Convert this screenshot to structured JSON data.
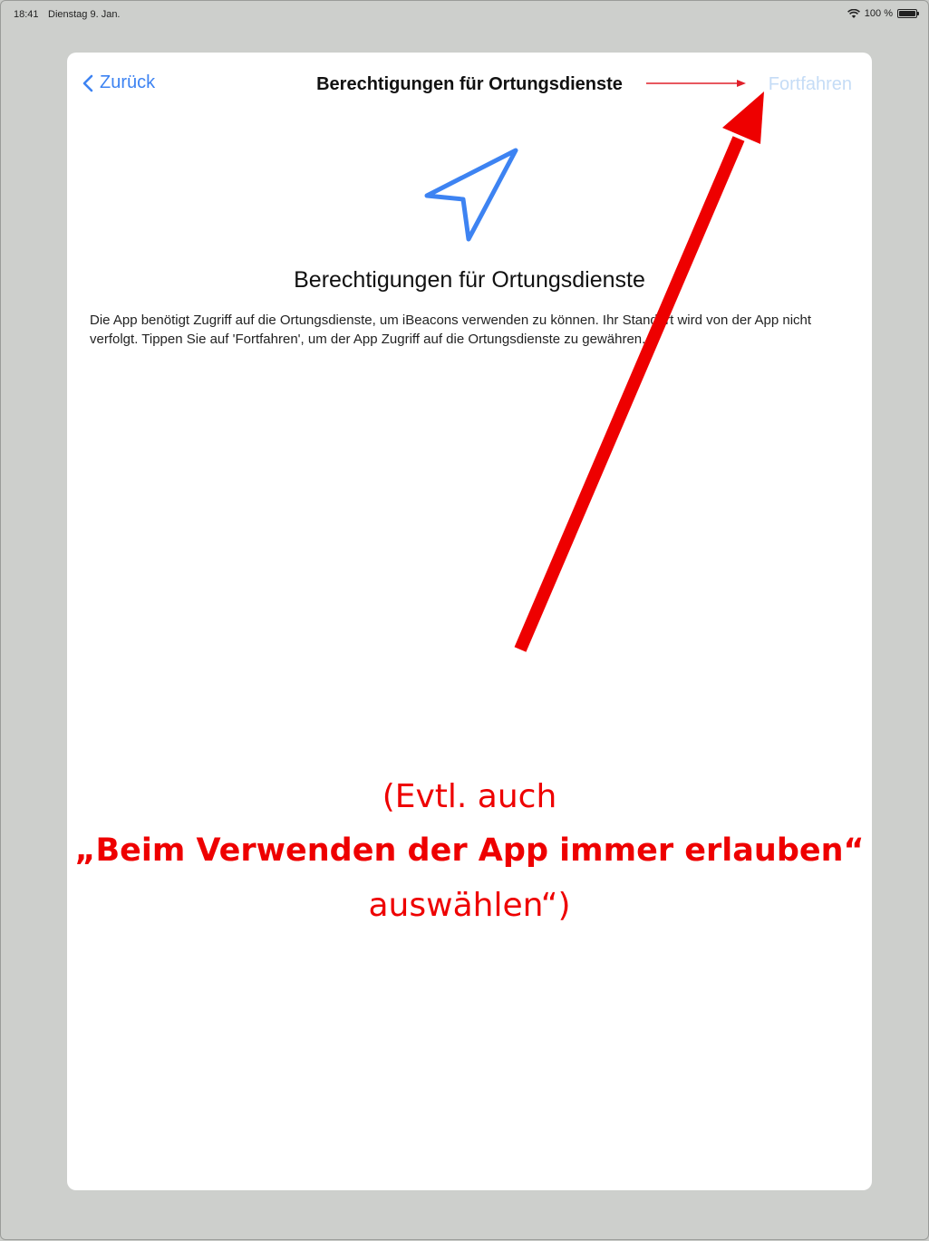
{
  "status_bar": {
    "time": "18:41",
    "date": "Dienstag 9. Jan.",
    "battery_text": "100 %"
  },
  "nav": {
    "back_label": "Zurück",
    "title": "Berechtigungen für Ortungsdienste",
    "continue_label": "Fortfahren"
  },
  "content": {
    "icon": "location-arrow-icon",
    "title": "Berechtigungen für Ortungsdienste",
    "body": "Die App benötigt Zugriff auf die Ortungsdienste, um iBeacons verwenden zu können. Ihr Standort wird von der App nicht verfolgt. Tippen Sie auf 'Fortfahren', um der App Zugriff auf die Ortungsdienste zu gewähren."
  },
  "annotation": {
    "line1": "(Evtl. auch",
    "line2": "„Beim Verwenden der App immer erlauben“",
    "line3": "auswählen“)",
    "color": "#ee0000"
  },
  "colors": {
    "accent": "#3d83f2",
    "disabled_accent": "#c5dcf6",
    "annotation_red": "#ee0000"
  }
}
